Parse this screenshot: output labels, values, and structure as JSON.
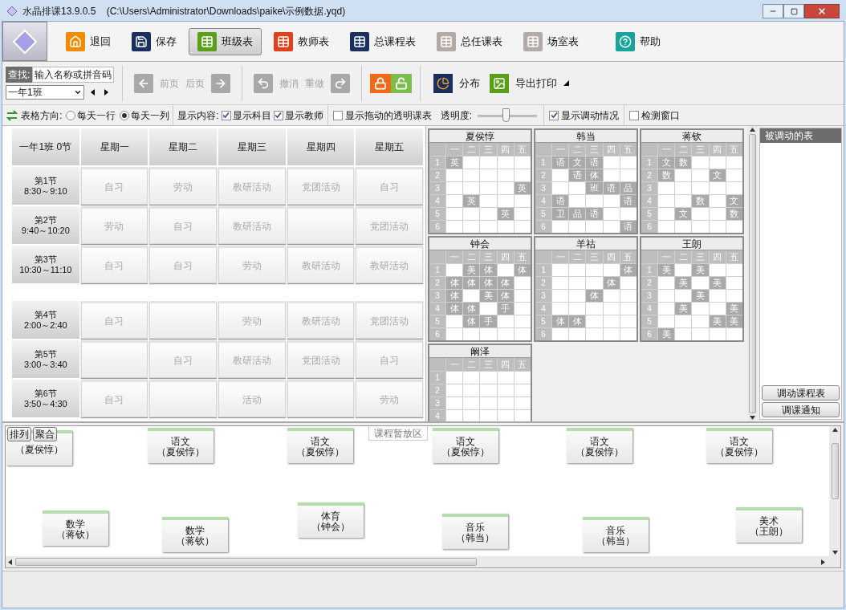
{
  "window": {
    "title": "水晶排课13.9.0.5    (C:\\Users\\Administrator\\Downloads\\paike\\示例数据.yqd)"
  },
  "main_toolbar": [
    {
      "label": "退回",
      "kind": "home",
      "color": "#f08c00",
      "selected": false
    },
    {
      "label": "保存",
      "kind": "save",
      "color": "#1b2f5e",
      "selected": false
    },
    {
      "label": "班级表",
      "kind": "table",
      "color": "#5a9e1c",
      "selected": true
    },
    {
      "label": "教师表",
      "kind": "table",
      "color": "#e0401a",
      "selected": false
    },
    {
      "label": "总课程表",
      "kind": "table",
      "color": "#1b2f5e",
      "selected": false
    },
    {
      "label": "总任课表",
      "kind": "table",
      "color": "#b3a9a5",
      "selected": false
    },
    {
      "label": "场室表",
      "kind": "table",
      "color": "#b3a9a5",
      "selected": false
    },
    {
      "label": "帮助",
      "kind": "help",
      "color": "#1aa39a",
      "selected": false
    }
  ],
  "search": {
    "label": "查找:",
    "placeholder": "输入名称或拼音码"
  },
  "class_select": {
    "value": "一年1班"
  },
  "nav": [
    {
      "label": "前页",
      "kind": "back",
      "disabled": true
    },
    {
      "label": "后页",
      "kind": "forward",
      "disabled": true
    },
    {
      "label": "撤消",
      "kind": "undo",
      "disabled": true
    },
    {
      "label": "重做",
      "kind": "redo",
      "disabled": true
    }
  ],
  "tools": [
    {
      "label": "分布",
      "kind": "pie"
    },
    {
      "label": "导出打印",
      "kind": "export"
    }
  ],
  "options": {
    "direction_label": "表格方向:",
    "directions": [
      {
        "label": "每天一行",
        "selected": false
      },
      {
        "label": "每天一列",
        "selected": true
      }
    ],
    "content_label": "显示内容:",
    "content": [
      {
        "label": "显示科目",
        "checked": true
      },
      {
        "label": "显示教师",
        "checked": true
      }
    ],
    "drag_table": {
      "label": "显示拖动的透明课表",
      "checked": false
    },
    "opacity": {
      "label": "透明度:",
      "level": 0.47
    },
    "show_changes": {
      "label": "显示调动情况",
      "checked": true
    },
    "detect": {
      "label": "检测窗口",
      "checked": false
    }
  },
  "timetable": {
    "corner": "一年1班 0节",
    "days": [
      "星期一",
      "星期二",
      "星期三",
      "星期四",
      "星期五"
    ],
    "morning": [
      {
        "period": "第1节",
        "time": "8:30～9:10",
        "cells": [
          "自习",
          "劳动",
          "教研活动",
          "党团活动",
          "自习"
        ]
      },
      {
        "period": "第2节",
        "time": "9:40～10:20",
        "cells": [
          "劳动",
          "自习",
          "教研活动",
          null,
          "党团活动"
        ]
      },
      {
        "period": "第3节",
        "time": "10:30～11:10",
        "cells": [
          "自习",
          "自习",
          "劳动",
          "教研活动",
          "教研活动"
        ]
      }
    ],
    "afternoon": [
      {
        "period": "第4节",
        "time": "2:00～2:40",
        "cells": [
          "自习",
          null,
          "劳动",
          "教研活动",
          "党团活动"
        ]
      },
      {
        "period": "第5节",
        "time": "3:00～3:40",
        "cells": [
          null,
          "自习",
          "教研活动",
          "党团活动",
          "自习"
        ]
      },
      {
        "period": "第6节",
        "time": "3:50～4:30",
        "cells": [
          "自习",
          null,
          "活动",
          null,
          "劳动"
        ]
      }
    ]
  },
  "teacher_grids": [
    {
      "name": "夏侯惇",
      "days": [
        "一",
        "二",
        "三",
        "四",
        "五"
      ],
      "rows": [
        {
          "label": "1",
          "cells": [
            "英",
            null,
            null,
            null,
            null
          ]
        },
        {
          "label": "2",
          "cells": [
            null,
            null,
            null,
            null,
            null
          ]
        },
        {
          "label": "3",
          "cells": [
            null,
            null,
            null,
            null,
            "英"
          ]
        },
        {
          "label": "4",
          "cells": [
            null,
            "英",
            null,
            null,
            null
          ]
        },
        {
          "label": "5",
          "cells": [
            null,
            null,
            null,
            "英",
            null
          ]
        },
        {
          "label": "6",
          "cells": [
            null,
            null,
            null,
            null,
            null
          ]
        }
      ]
    },
    {
      "name": "韩当",
      "days": [
        "一",
        "二",
        "三",
        "四",
        "五"
      ],
      "rows": [
        {
          "label": "1",
          "cells": [
            "语",
            "文",
            "语",
            null,
            null
          ]
        },
        {
          "label": "2",
          "cells": [
            null,
            "语",
            "体",
            null,
            null
          ]
        },
        {
          "label": "3",
          "cells": [
            null,
            null,
            "班",
            "语",
            "品"
          ]
        },
        {
          "label": "4",
          "cells": [
            "语",
            null,
            null,
            null,
            "语"
          ]
        },
        {
          "label": "5",
          "cells": [
            "卫",
            "品",
            "语",
            null,
            null
          ]
        },
        {
          "label": "6",
          "cells": [
            null,
            null,
            null,
            null,
            "语"
          ]
        }
      ]
    },
    {
      "name": "蒋钦",
      "days": [
        "一",
        "二",
        "三",
        "四",
        "五"
      ],
      "rows": [
        {
          "label": "1",
          "cells": [
            "文",
            "数",
            null,
            null,
            null
          ]
        },
        {
          "label": "2",
          "cells": [
            "数",
            null,
            null,
            "文",
            null
          ]
        },
        {
          "label": "3",
          "cells": [
            null,
            null,
            null,
            null,
            null
          ]
        },
        {
          "label": "4",
          "cells": [
            null,
            null,
            "数",
            null,
            "文"
          ]
        },
        {
          "label": "5",
          "cells": [
            null,
            "文",
            null,
            null,
            "数"
          ]
        },
        {
          "label": "6",
          "cells": [
            null,
            null,
            null,
            null,
            null
          ]
        }
      ]
    },
    {
      "name": "钟会",
      "days": [
        "一",
        "二",
        "三",
        "四",
        "五"
      ],
      "rows": [
        {
          "label": "1",
          "cells": [
            null,
            "美",
            "体",
            null,
            "体"
          ]
        },
        {
          "label": "2",
          "cells": [
            "体",
            "体",
            "体",
            "体",
            null
          ]
        },
        {
          "label": "3",
          "cells": [
            "体",
            null,
            "美",
            "体",
            null
          ]
        },
        {
          "label": "4",
          "cells": [
            "体",
            "体",
            null,
            "手",
            null
          ]
        },
        {
          "label": "5",
          "cells": [
            null,
            "体",
            "手",
            null,
            null
          ]
        },
        {
          "label": "6",
          "cells": [
            null,
            null,
            null,
            null,
            null
          ]
        }
      ]
    },
    {
      "name": "羊祜",
      "days": [
        "一",
        "二",
        "三",
        "四",
        "五"
      ],
      "rows": [
        {
          "label": "1",
          "cells": [
            null,
            null,
            null,
            null,
            "体"
          ]
        },
        {
          "label": "2",
          "cells": [
            null,
            null,
            null,
            "体",
            null
          ]
        },
        {
          "label": "3",
          "cells": [
            null,
            null,
            "体",
            null,
            null
          ]
        },
        {
          "label": "4",
          "cells": [
            null,
            null,
            null,
            null,
            null
          ]
        },
        {
          "label": "5",
          "cells": [
            "体",
            "体",
            null,
            null,
            null
          ]
        },
        {
          "label": "6",
          "cells": [
            null,
            null,
            null,
            null,
            null
          ]
        }
      ]
    },
    {
      "name": "王朗",
      "days": [
        "一",
        "二",
        "三",
        "四",
        "五"
      ],
      "rows": [
        {
          "label": "1",
          "cells": [
            "美",
            null,
            "美",
            null,
            null
          ]
        },
        {
          "label": "2",
          "cells": [
            null,
            "美",
            null,
            "美",
            null
          ]
        },
        {
          "label": "3",
          "cells": [
            null,
            null,
            "美",
            null,
            null
          ]
        },
        {
          "label": "4",
          "cells": [
            null,
            "美",
            null,
            null,
            "美"
          ]
        },
        {
          "label": "5",
          "cells": [
            null,
            null,
            null,
            "美",
            "美"
          ]
        },
        {
          "label": "6",
          "cells": [
            "美",
            null,
            null,
            null,
            null
          ]
        }
      ]
    },
    {
      "name": "阚泽",
      "days": [
        "一",
        "二",
        "三",
        "四",
        "五"
      ],
      "rows": [
        {
          "label": "1",
          "cells": [
            null,
            null,
            null,
            null,
            null
          ]
        },
        {
          "label": "2",
          "cells": [
            null,
            null,
            null,
            null,
            null
          ]
        },
        {
          "label": "3",
          "cells": [
            null,
            null,
            null,
            null,
            null
          ]
        },
        {
          "label": "4",
          "cells": [
            null,
            null,
            null,
            null,
            null
          ]
        }
      ]
    }
  ],
  "changed_panel": {
    "title": "被调动的表",
    "buttons": [
      "调动课程表",
      "调课通知"
    ]
  },
  "staging": {
    "title": "课程暂放区",
    "buttons": [
      "排列",
      "聚合"
    ],
    "cards": [
      {
        "teacher": "（夏侯惇）"
      },
      {
        "subject": "语文",
        "teacher": "（夏侯惇）"
      },
      {
        "subject": "语文",
        "teacher": "（夏侯惇）"
      },
      {
        "subject": "语文",
        "teacher": "（夏侯惇）"
      },
      {
        "subject": "语文",
        "teacher": "（夏侯惇）"
      },
      {
        "subject": "语文",
        "teacher": "（夏侯惇）"
      },
      {
        "subject": "数学",
        "teacher": "（蒋钦）"
      },
      {
        "subject": "数学",
        "teacher": "（蒋钦）"
      },
      {
        "subject": "体育",
        "teacher": "（钟会）"
      },
      {
        "subject": "音乐",
        "teacher": "（韩当）"
      },
      {
        "subject": "音乐",
        "teacher": "（韩当）"
      },
      {
        "subject": "美术",
        "teacher": "（王朗）"
      }
    ]
  }
}
